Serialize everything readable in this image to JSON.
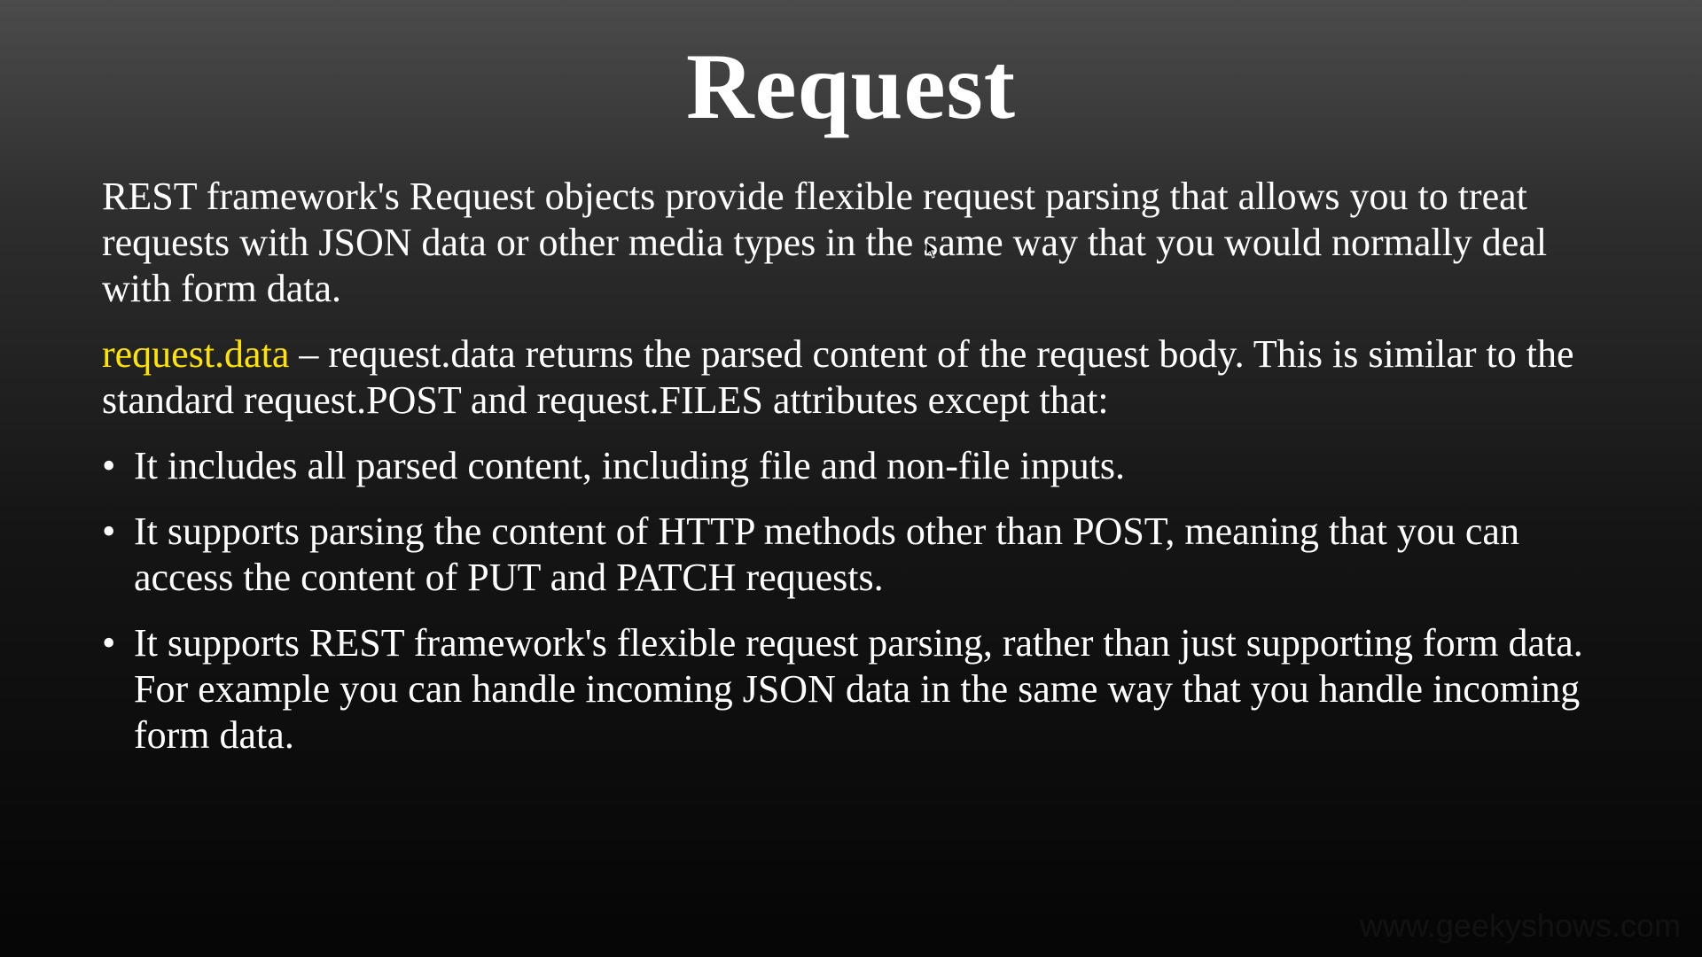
{
  "slide": {
    "title": "Request",
    "intro": "REST framework's Request objects provide flexible request parsing that allows you to treat requests with JSON data or other media types in the same way that you would normally deal with form data.",
    "data_term": "request.data",
    "data_desc": " – request.data returns the parsed content of the request body. This is similar to the standard request.POST and request.FILES attributes except that:",
    "bullet_symbol": "•",
    "bullets": [
      "It includes all parsed content, including file and non-file inputs.",
      "It supports parsing the content of HTTP methods other than POST, meaning that you can access the content of PUT and PATCH requests.",
      "It supports REST framework's flexible request parsing, rather than just supporting form data. For example you can handle incoming JSON data in the same way that you handle incoming form data."
    ],
    "watermark": "www.geekyshows.com"
  },
  "colors": {
    "highlight": "#ffe400",
    "text": "#ffffff"
  },
  "icons": {
    "cursor": "mouse-pointer-icon"
  }
}
